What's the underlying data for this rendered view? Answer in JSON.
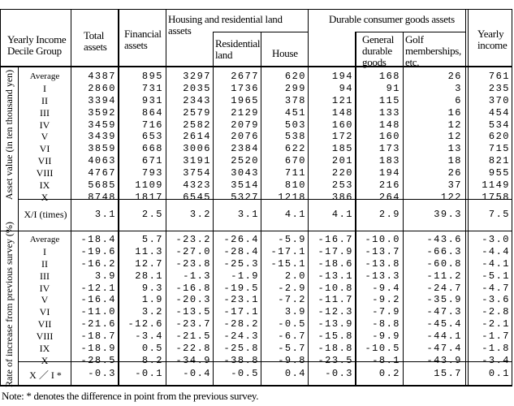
{
  "header": {
    "group": "Yearly Income Decile Group",
    "total_assets": "Total assets",
    "financial_assets": "Financial assets",
    "housing": "Housing and residential land assets",
    "residential_land": "Residential land",
    "house": "House",
    "durable": "Durable consumer goods assets",
    "general_durable": "General durable goods",
    "golf": "Golf memberships, etc.",
    "yearly_income": "Yearly income"
  },
  "sections": {
    "asset_value_label": "Asset value (in ten thousand yen)",
    "rate_label": "Rate of increase from previous survey (%)"
  },
  "groups": [
    "Average",
    "I",
    "II",
    "III",
    "IV",
    "V",
    "VI",
    "VII",
    "VIII",
    "IX",
    "X"
  ],
  "asset_value": {
    "total_assets": [
      "4387",
      "2860",
      "3394",
      "3592",
      "3459",
      "3439",
      "3859",
      "4063",
      "4767",
      "5685",
      "8748"
    ],
    "financial_assets": [
      "895",
      "731",
      "931",
      "864",
      "716",
      "653",
      "668",
      "671",
      "793",
      "1109",
      "1817"
    ],
    "housing_total": [
      "3297",
      "2035",
      "2343",
      "2579",
      "2582",
      "2614",
      "3006",
      "3191",
      "3754",
      "4323",
      "6545"
    ],
    "residential_land": [
      "2677",
      "1736",
      "1965",
      "2129",
      "2079",
      "2076",
      "2384",
      "2520",
      "3043",
      "3514",
      "5327"
    ],
    "house": [
      "620",
      "299",
      "378",
      "451",
      "503",
      "538",
      "622",
      "670",
      "711",
      "810",
      "1218"
    ],
    "durable_total": [
      "194",
      "94",
      "121",
      "148",
      "160",
      "172",
      "185",
      "201",
      "220",
      "253",
      "386"
    ],
    "general_durable": [
      "168",
      "91",
      "115",
      "133",
      "148",
      "160",
      "173",
      "183",
      "194",
      "216",
      "264"
    ],
    "golf": [
      "26",
      "3",
      "6",
      "16",
      "12",
      "12",
      "13",
      "18",
      "26",
      "37",
      "122"
    ],
    "yearly_income": [
      "761",
      "235",
      "370",
      "454",
      "534",
      "620",
      "715",
      "821",
      "955",
      "1149",
      "1758"
    ]
  },
  "ratio_row": {
    "label": "X/I (times)",
    "values": [
      "3.1",
      "2.5",
      "3.2",
      "3.1",
      "4.1",
      "4.1",
      "2.9",
      "39.3",
      "7.5"
    ]
  },
  "rate_of_increase": {
    "total_assets": [
      "-18.4",
      "-19.6",
      "-16.2",
      "3.9",
      "-12.1",
      "-16.4",
      "-11.0",
      "-21.6",
      "-18.7",
      "-18.9",
      "-28.5"
    ],
    "financial_assets": [
      "5.7",
      "11.3",
      "12.7",
      "28.1",
      "9.3",
      "1.9",
      "3.2",
      "-12.6",
      "-3.4",
      "0.5",
      "8.2"
    ],
    "housing_total": [
      "-23.2",
      "-27.0",
      "-23.8",
      "-1.3",
      "-16.8",
      "-20.3",
      "-13.5",
      "-23.7",
      "-21.5",
      "-22.8",
      "-34.9"
    ],
    "residential_land": [
      "-26.4",
      "-28.4",
      "-25.3",
      "-1.9",
      "-19.5",
      "-23.1",
      "-17.1",
      "-28.2",
      "-24.3",
      "-25.8",
      "-38.8"
    ],
    "house": [
      "-5.9",
      "-17.1",
      "-15.1",
      "2.0",
      "-2.9",
      "-7.2",
      "3.9",
      "-0.5",
      "-6.7",
      "-5.7",
      "-9.8"
    ],
    "durable_total": [
      "-16.7",
      "-17.9",
      "-18.6",
      "-13.1",
      "-10.8",
      "-11.7",
      "-12.3",
      "-13.9",
      "-15.8",
      "-18.8",
      "-23.5"
    ],
    "general_durable": [
      "-10.0",
      "-13.7",
      "-13.8",
      "-13.3",
      "-9.4",
      "-9.2",
      "-7.9",
      "-8.8",
      "-9.9",
      "-10.5",
      "-8.1"
    ],
    "golf": [
      "-43.6",
      "-66.3",
      "-60.8",
      "-11.2",
      "-24.7",
      "-35.9",
      "-47.3",
      "-45.4",
      "-44.1",
      "-47.4",
      "-43.9"
    ],
    "yearly_income": [
      "-3.0",
      "-4.4",
      "-4.1",
      "-5.1",
      "-4.7",
      "-3.6",
      "-2.8",
      "-2.1",
      "-1.7",
      "-1.8",
      "-3.4"
    ]
  },
  "rate_ratio_row": {
    "label": "X ／ I *",
    "values": [
      "-0.3",
      "-0.1",
      "-0.4",
      "-0.5",
      "0.4",
      "-0.3",
      "0.2",
      "15.7",
      "0.1"
    ]
  },
  "note": "Note: * denotes the difference in point from the previous survey."
}
